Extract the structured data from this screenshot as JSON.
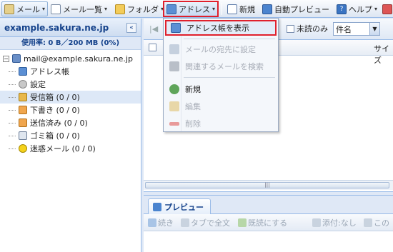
{
  "toolbar": {
    "mail": "メール",
    "mail_list": "メール一覧",
    "folder": "フォルダ",
    "address": "アドレス",
    "new": "新規",
    "auto_preview": "自動プレビュー",
    "help": "ヘルプ"
  },
  "left": {
    "title": "example.sakura.ne.jp",
    "usage": "使用率: 0 B／200 MB (0%)",
    "account": "mail@example.sakura.ne.jp",
    "items": [
      {
        "label": "アドレス帳"
      },
      {
        "label": "設定"
      },
      {
        "label": "受信箱 (0 / 0)"
      },
      {
        "label": "下書き (0 / 0)"
      },
      {
        "label": "送信済み (0 / 0)"
      },
      {
        "label": "ゴミ箱 (0 / 0)"
      },
      {
        "label": "迷惑メール (0 / 0)"
      }
    ]
  },
  "grid": {
    "unread_only": "未読のみ",
    "filter_value": "件名",
    "size_column": "サイズ"
  },
  "menu": {
    "show_address_book": "アドレス帳を表示",
    "set_as_recipient": "メールの宛先に設定",
    "search_related": "関連するメールを検索",
    "new": "新規",
    "edit": "編集",
    "delete": "削除"
  },
  "preview": {
    "tab": "プレビュー",
    "continue": "続き",
    "tab_full": "タブで全文",
    "mark_read": "既読にする",
    "attachment": "添付:なし",
    "more": "この"
  }
}
